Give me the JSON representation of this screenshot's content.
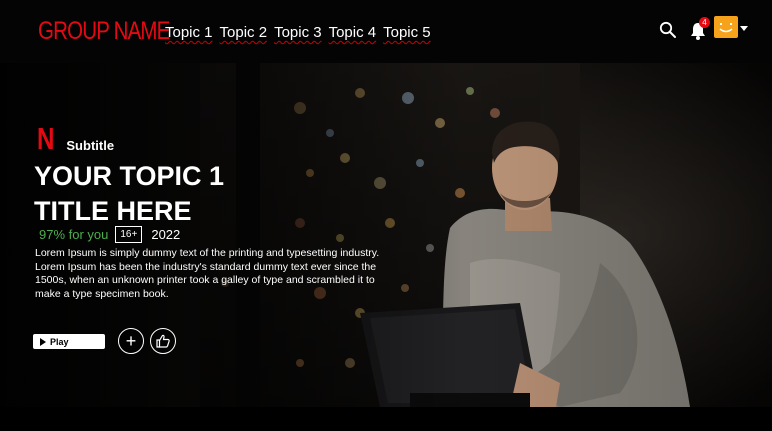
{
  "header": {
    "brand": "GROUP NAME",
    "nav": [
      "Topic 1",
      "Topic 2",
      "Topic 3",
      "Topic 4",
      "Topic 5"
    ],
    "notification_count": "4",
    "icons": [
      "search-icon",
      "bell-icon",
      "avatar-smile-icon",
      "caret-down-icon"
    ]
  },
  "hero": {
    "series_logo": "N",
    "subtitle": "Subtitle",
    "title": "YOUR TOPIC 1 TITLE HERE",
    "match": "97% for you",
    "age_rating": "16+",
    "year": "2022",
    "description": "Lorem Ipsum is simply dummy text of the printing and typesetting industry. Lorem Ipsum has been the industry's standard dummy text ever since the 1500s, when an unknown printer took a galley of type and scrambled it to make a type specimen book.",
    "play_label": "Play",
    "add_label": "+"
  },
  "colors": {
    "brand": "#e50914",
    "match": "#4cae4c",
    "avatar": "#f7a21b"
  }
}
